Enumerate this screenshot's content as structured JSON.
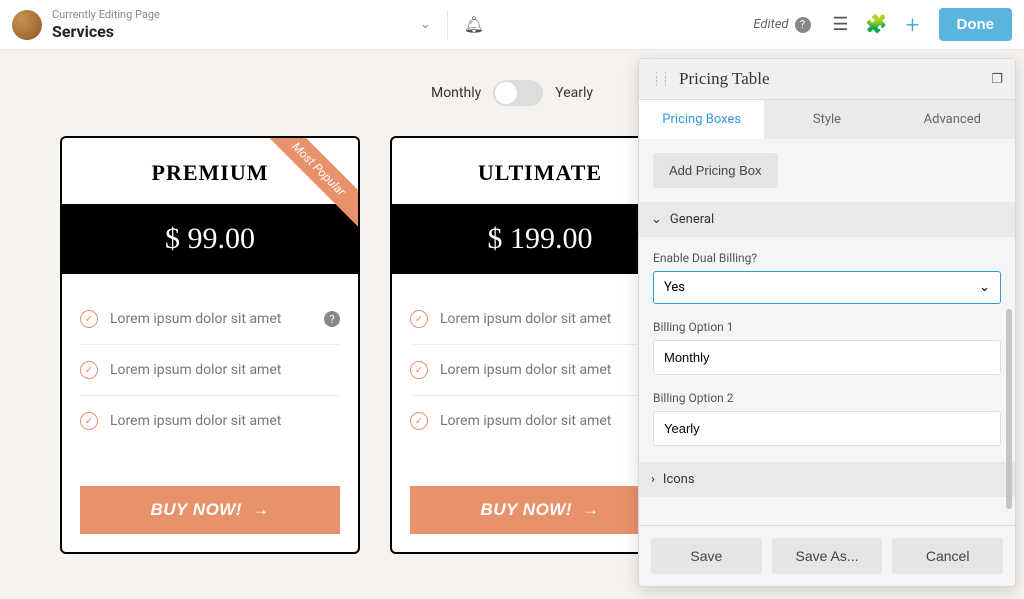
{
  "topbar": {
    "subtitle": "Currently Editing Page",
    "title": "Services",
    "edited": "Edited",
    "done": "Done"
  },
  "toggle": {
    "left": "Monthly",
    "right": "Yearly"
  },
  "cards": [
    {
      "title": "PREMIUM",
      "price": "$ 99.00",
      "ribbon": "Most Popular",
      "features": [
        "Lorem ipsum dolor sit amet",
        "Lorem ipsum dolor sit amet",
        "Lorem ipsum dolor sit amet"
      ],
      "cta": "BUY NOW!"
    },
    {
      "title": "ULTIMATE",
      "price": "$ 199.00",
      "features": [
        "Lorem ipsum dolor sit amet",
        "Lorem ipsum dolor sit amet",
        "Lorem ipsum dolor sit amet"
      ],
      "cta": "BUY NOW!"
    }
  ],
  "panel": {
    "title": "Pricing Table",
    "tabs": [
      "Pricing Boxes",
      "Style",
      "Advanced"
    ],
    "add_box": "Add Pricing Box",
    "sections": {
      "general": "General",
      "icons": "Icons"
    },
    "fields": {
      "dual_label": "Enable Dual Billing?",
      "dual_value": "Yes",
      "opt1_label": "Billing Option 1",
      "opt1_value": "Monthly",
      "opt2_label": "Billing Option 2",
      "opt2_value": "Yearly"
    },
    "footer": {
      "save": "Save",
      "save_as": "Save As...",
      "cancel": "Cancel"
    }
  }
}
